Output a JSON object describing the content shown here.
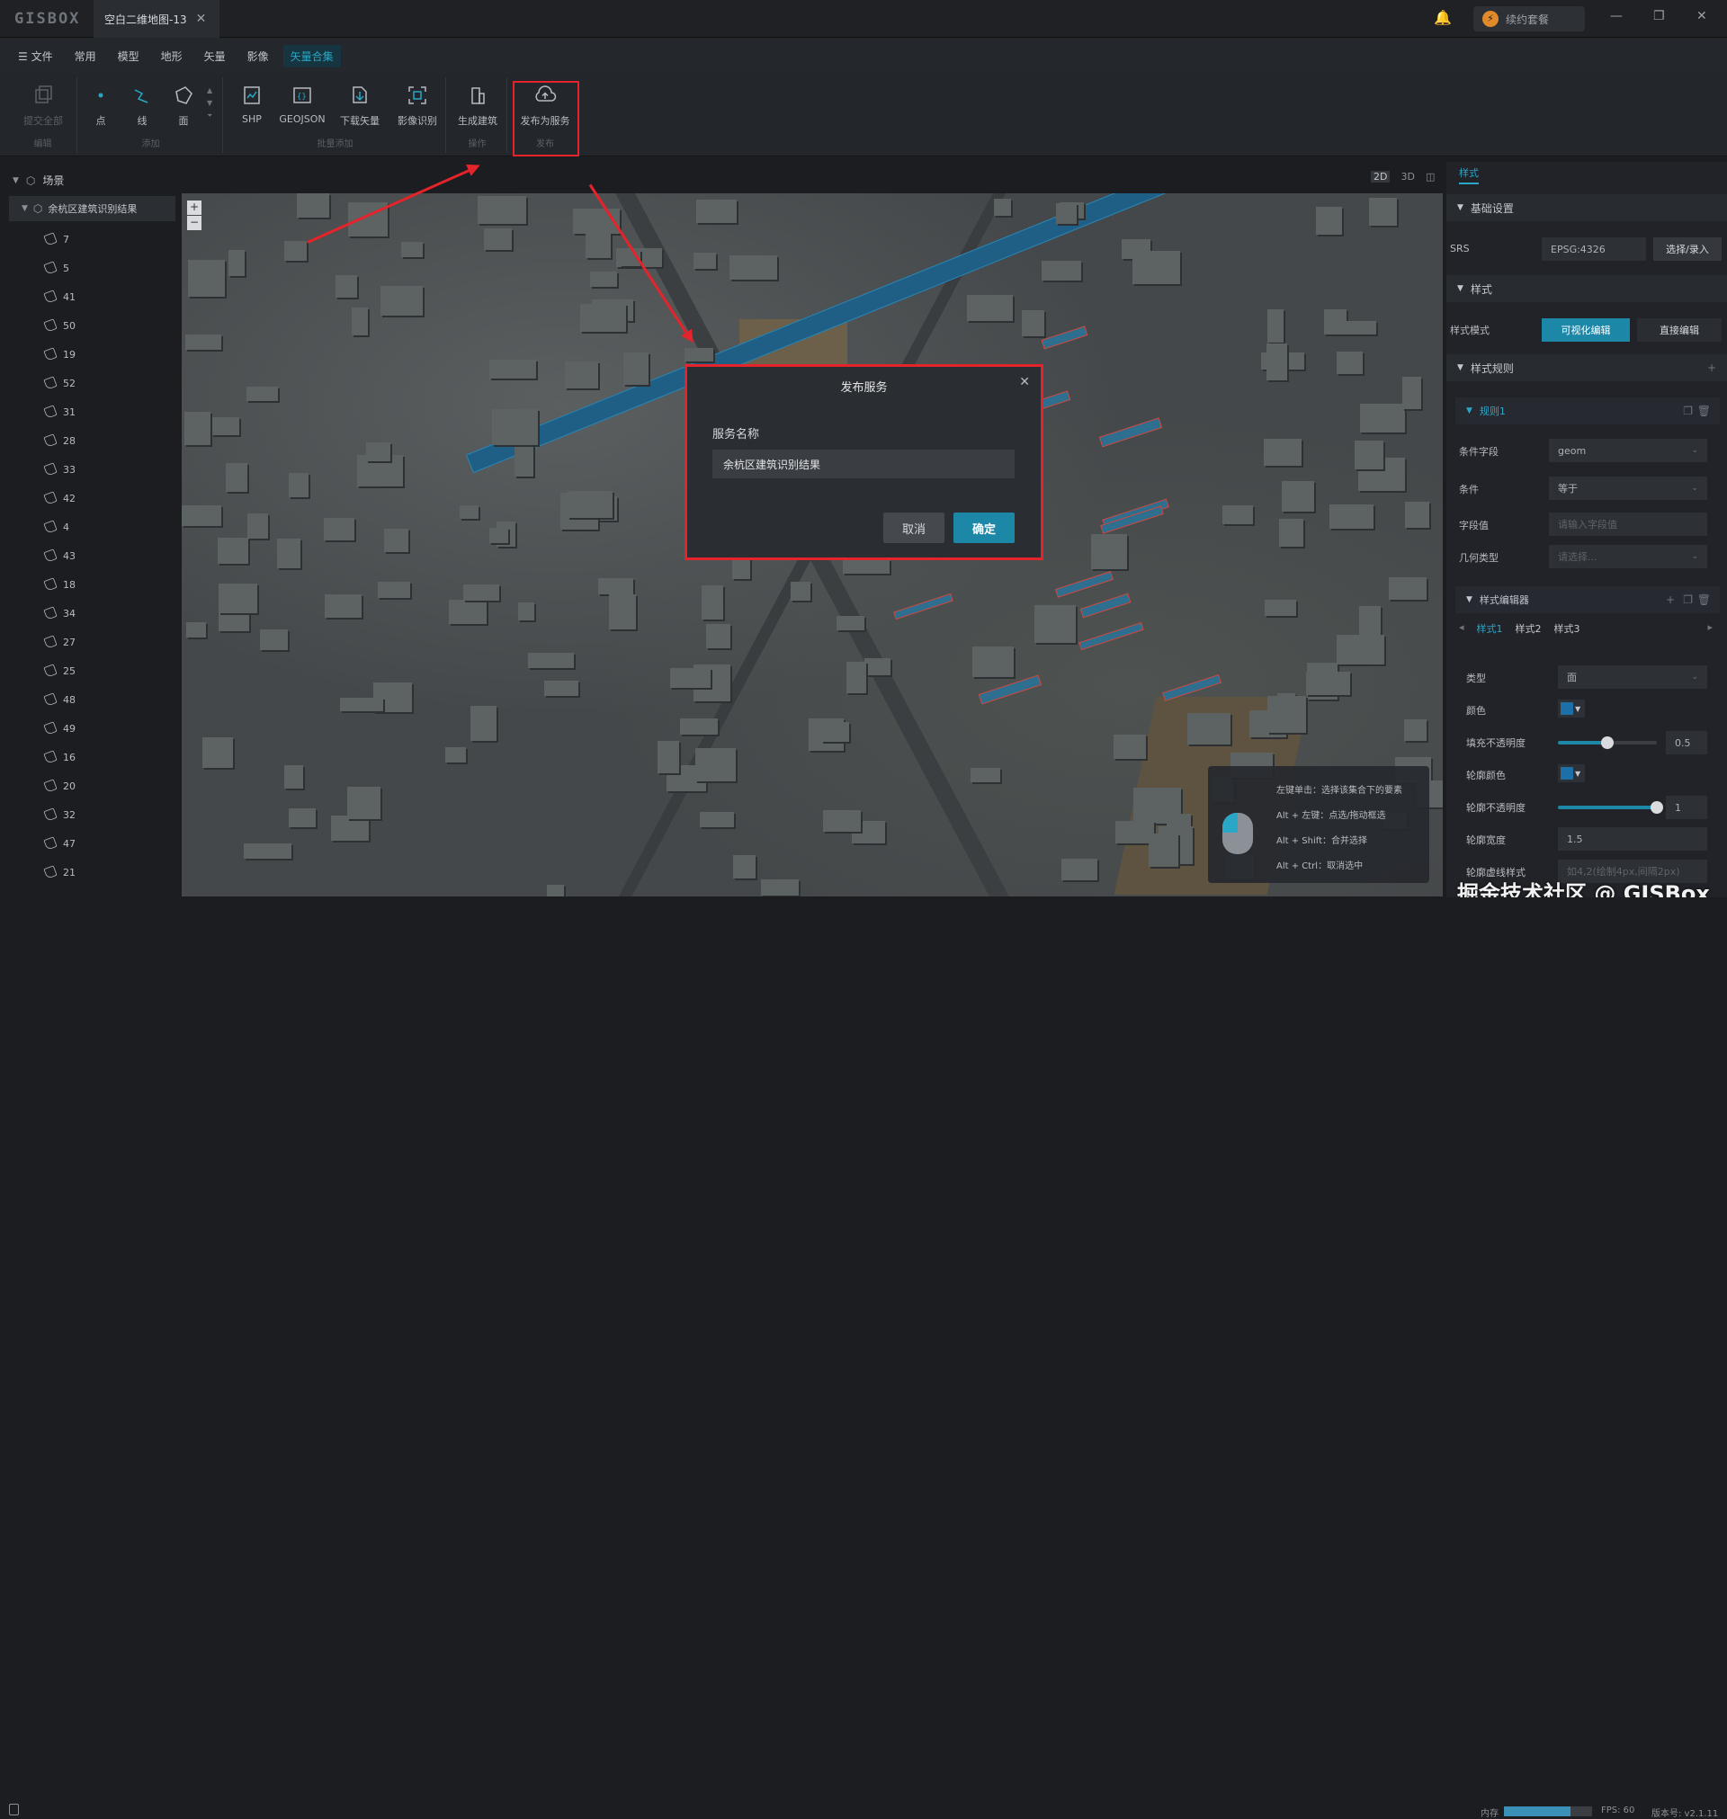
{
  "app": {
    "logo": "GISBOX",
    "tab_title": "空白二维地图-13",
    "renew_label": "续约套餐"
  },
  "menu": {
    "file": "文件",
    "items": [
      "常用",
      "模型",
      "地形",
      "矢量",
      "影像",
      "矢量合集"
    ],
    "active_index": 5
  },
  "ribbon": {
    "groups": {
      "edit": "编辑",
      "add": "添加",
      "batch_add": "批量添加",
      "operate": "操作",
      "publish": "发布"
    },
    "buttons": {
      "commit_all": "提交全部",
      "point": "点",
      "line": "线",
      "polygon": "面",
      "shp": "SHP",
      "geojson": "GEOJSON",
      "download_vector": "下载矢量",
      "image_recognition": "影像识别",
      "generate_building": "生成建筑",
      "publish_service": "发布为服务"
    }
  },
  "scene": {
    "header": "场景",
    "layer": "余杭区建筑识别结果",
    "features": [
      "7",
      "5",
      "41",
      "50",
      "19",
      "52",
      "31",
      "28",
      "33",
      "42",
      "4",
      "43",
      "18",
      "34",
      "27",
      "25",
      "48",
      "49",
      "16",
      "20",
      "32",
      "47",
      "21"
    ]
  },
  "view_modes": [
    "2D",
    "3D"
  ],
  "dialog": {
    "title": "发布服务",
    "label": "服务名称",
    "value": "余杭区建筑识别结果",
    "cancel": "取消",
    "ok": "确定"
  },
  "hints": [
    "左键单击：选择该集合下的要素",
    "Alt + 左键：点选/拖动框选",
    "Alt + Shift：合并选择",
    "Alt + Ctrl：取消选中"
  ],
  "panel": {
    "tab": "样式",
    "basic": "基础设置",
    "srs_label": "SRS",
    "srs_value": "EPSG:4326",
    "srs_button": "选择/录入",
    "style": "样式",
    "style_mode_label": "样式模式",
    "visual_edit": "可视化编辑",
    "direct_edit": "直接编辑",
    "style_rules": "样式规则",
    "rule1": "规则1",
    "cond_field_label": "条件字段",
    "cond_field_value": "geom",
    "cond_label": "条件",
    "cond_value": "等于",
    "field_value_label": "字段值",
    "field_value_placeholder": "请输入字段值",
    "geom_type_label": "几何类型",
    "geom_type_placeholder": "请选择...",
    "style_editor": "样式编辑器",
    "style_tabs": [
      "样式1",
      "样式2",
      "样式3"
    ],
    "type_label": "类型",
    "type_value": "面",
    "color_label": "颜色",
    "fill_opacity_label": "填充不透明度",
    "fill_opacity_value": "0.5",
    "outline_color_label": "轮廓颜色",
    "outline_opacity_label": "轮廓不透明度",
    "outline_opacity_value": "1",
    "outline_width_label": "轮廓宽度",
    "outline_width_value": "1.5",
    "dash_label": "轮廓虚线样式",
    "dash_placeholder": "如4,2(绘制4px,间隔2px)",
    "accent": "#1d87a8"
  },
  "status": {
    "memory_label": "内存",
    "memory_fraction": 0.75,
    "fps": "FPS: 60",
    "version": "版本号: v2.1.11"
  },
  "watermark": "掘金技术社区 @ GISBox"
}
